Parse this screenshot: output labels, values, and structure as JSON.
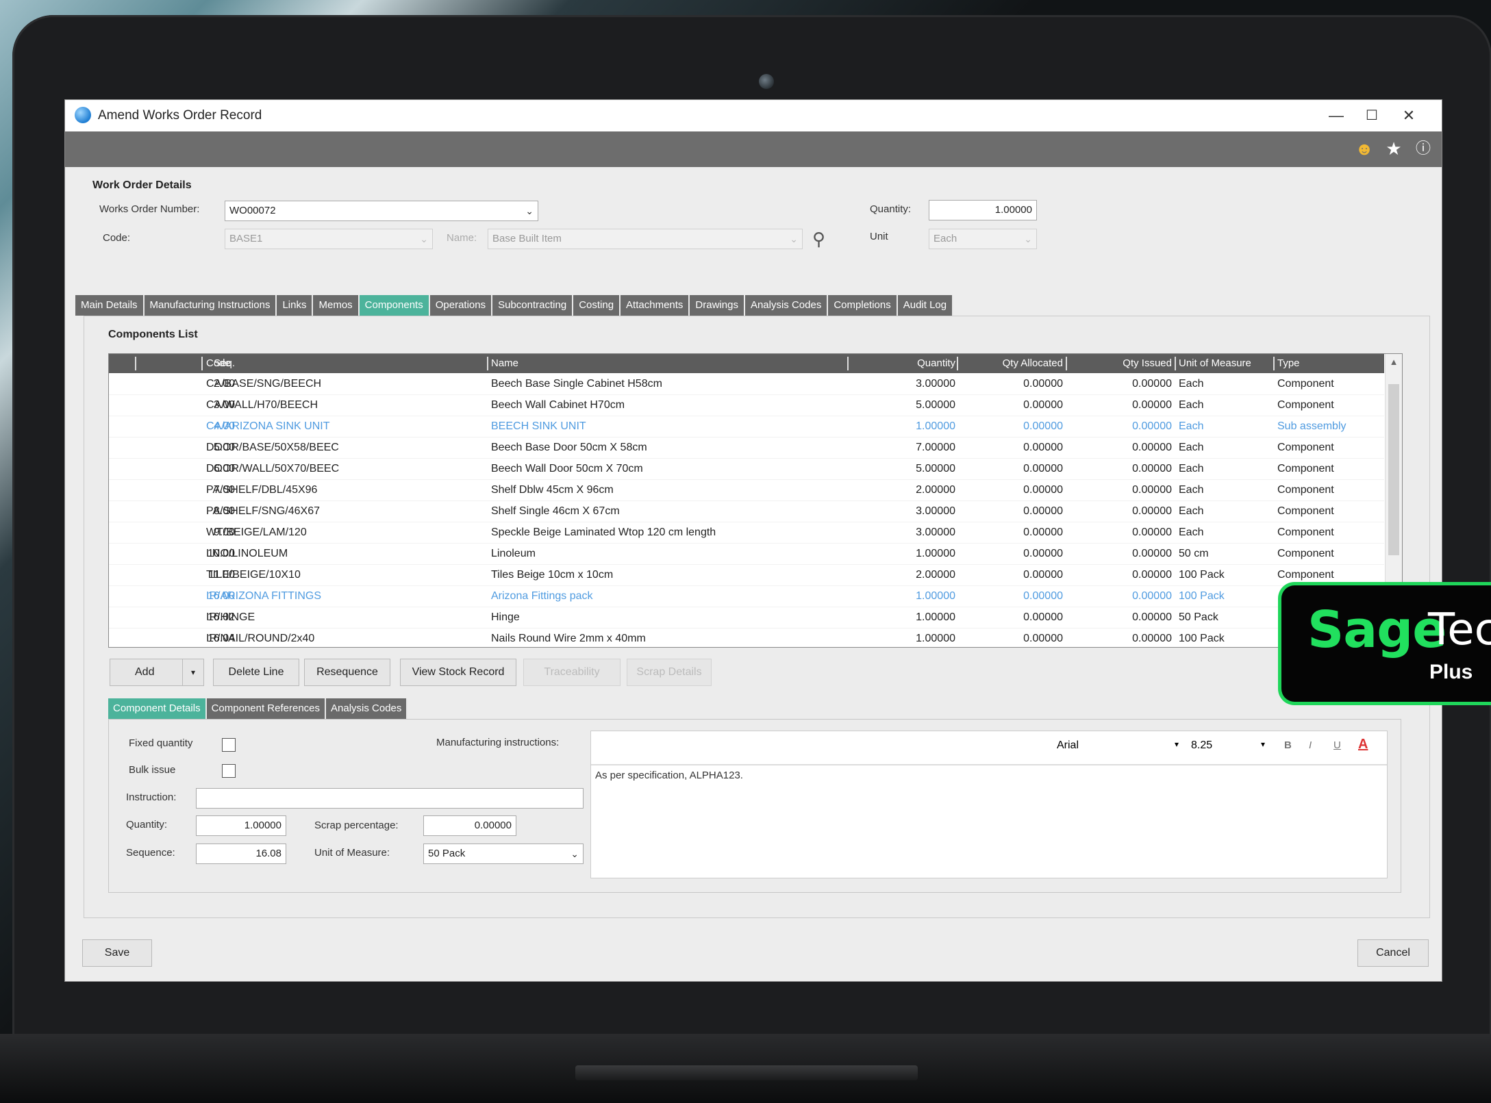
{
  "window": {
    "title": "Amend Works Order Record",
    "controls": {
      "minimize": "—",
      "maximize": "☐",
      "close": "✕"
    },
    "toolbar_icons": [
      "smiley-icon",
      "star-icon",
      "help-icon"
    ]
  },
  "work_order": {
    "section_title": "Work Order Details",
    "number_label": "Works Order Number:",
    "number_value": "WO00072",
    "code_label": "Code:",
    "code_value": "BASE1",
    "name_label": "Name:",
    "name_value": "Base Built Item",
    "quantity_label": "Quantity:",
    "quantity_value": "1.00000",
    "unit_label": "Unit",
    "unit_value": "Each"
  },
  "tabs": [
    {
      "label": "Main Details"
    },
    {
      "label": "Manufacturing Instructions"
    },
    {
      "label": "Links"
    },
    {
      "label": "Memos"
    },
    {
      "label": "Components",
      "active": true
    },
    {
      "label": "Operations"
    },
    {
      "label": "Subcontracting"
    },
    {
      "label": "Costing"
    },
    {
      "label": "Attachments"
    },
    {
      "label": "Drawings"
    },
    {
      "label": "Analysis Codes"
    },
    {
      "label": "Completions"
    },
    {
      "label": "Audit Log"
    }
  ],
  "components": {
    "section_title": "Components List",
    "columns": {
      "seq": "Seq.",
      "code": "Code",
      "name": "Name",
      "quantity": "Quantity",
      "qty_allocated": "Qty Allocated",
      "qty_issued": "Qty Issued",
      "unit_of_measure": "Unit of Measure",
      "type": "Type"
    },
    "rows": [
      {
        "seq": "2.00",
        "code": "CA/BASE/SNG/BEECH",
        "name": "Beech Base Single Cabinet H58cm",
        "quantity": "3.00000",
        "qty_allocated": "0.00000",
        "qty_issued": "0.00000",
        "uom": "Each",
        "type": "Component"
      },
      {
        "seq": "3.00",
        "code": "CA/WALL/H70/BEECH",
        "name": "Beech Wall Cabinet H70cm",
        "quantity": "5.00000",
        "qty_allocated": "0.00000",
        "qty_issued": "0.00000",
        "uom": "Each",
        "type": "Component"
      },
      {
        "seq": "4.00",
        "code": "CA/ARIZONA SINK UNIT",
        "name": "BEECH SINK UNIT",
        "quantity": "1.00000",
        "qty_allocated": "0.00000",
        "qty_issued": "0.00000",
        "uom": "Each",
        "type": "Sub assembly",
        "sub": true
      },
      {
        "seq": "5.00",
        "code": "DOOR/BASE/50X58/BEEC",
        "name": "Beech Base Door 50cm X 58cm",
        "quantity": "7.00000",
        "qty_allocated": "0.00000",
        "qty_issued": "0.00000",
        "uom": "Each",
        "type": "Component"
      },
      {
        "seq": "6.00",
        "code": "DOOR/WALL/50X70/BEEC",
        "name": "Beech Wall Door 50cm X 70cm",
        "quantity": "5.00000",
        "qty_allocated": "0.00000",
        "qty_issued": "0.00000",
        "uom": "Each",
        "type": "Component"
      },
      {
        "seq": "7.00",
        "code": "PA/SHELF/DBL/45X96",
        "name": "Shelf Dblw 45cm X 96cm",
        "quantity": "2.00000",
        "qty_allocated": "0.00000",
        "qty_issued": "0.00000",
        "uom": "Each",
        "type": "Component"
      },
      {
        "seq": "8.00",
        "code": "PA/SHELF/SNG/46X67",
        "name": "Shelf  Single 46cm X 67cm",
        "quantity": "3.00000",
        "qty_allocated": "0.00000",
        "qty_issued": "0.00000",
        "uom": "Each",
        "type": "Component"
      },
      {
        "seq": "9.00",
        "code": "WT/BEIGE/LAM/120",
        "name": "Speckle Beige Laminated Wtop 120 cm length",
        "quantity": "3.00000",
        "qty_allocated": "0.00000",
        "qty_issued": "0.00000",
        "uom": "Each",
        "type": "Component"
      },
      {
        "seq": "10.00",
        "code": "LNO/LINOLEUM",
        "name": "Linoleum",
        "quantity": "1.00000",
        "qty_allocated": "0.00000",
        "qty_issued": "0.00000",
        "uom": "50 cm",
        "type": "Component"
      },
      {
        "seq": "11.00",
        "code": "TILE/BEIGE/10X10",
        "name": "Tiles Beige 10cm x 10cm",
        "quantity": "2.00000",
        "qty_allocated": "0.00000",
        "qty_issued": "0.00000",
        "uom": "100 Pack",
        "type": "Component"
      },
      {
        "seq": "16.00",
        "code": "IR/ARIZONA FITTINGS",
        "name": "Arizona Fittings pack",
        "quantity": "1.00000",
        "qty_allocated": "0.00000",
        "qty_issued": "0.00000",
        "uom": "100 Pack",
        "type": "",
        "sub": true
      },
      {
        "seq": "16.02",
        "code": "IR/HINGE",
        "name": "Hinge",
        "quantity": "1.00000",
        "qty_allocated": "0.00000",
        "qty_issued": "0.00000",
        "uom": "50 Pack",
        "type": ""
      },
      {
        "seq": "16.04",
        "code": "IR/NAIL/ROUND/2x40",
        "name": "Nails Round Wire 2mm x 40mm",
        "quantity": "1.00000",
        "qty_allocated": "0.00000",
        "qty_issued": "0.00000",
        "uom": "100 Pack",
        "type": ""
      }
    ]
  },
  "actions": {
    "add": "Add",
    "delete_line": "Delete Line",
    "resequence": "Resequence",
    "view_stock_record": "View Stock Record",
    "traceability": "Traceability",
    "scrap_details": "Scrap Details"
  },
  "subtabs": [
    {
      "label": "Component Details",
      "active": true
    },
    {
      "label": "Component References"
    },
    {
      "label": "Analysis Codes"
    }
  ],
  "component_details": {
    "fixed_quantity_label": "Fixed quantity",
    "bulk_issue_label": "Bulk issue",
    "instruction_label": "Instruction:",
    "instruction_value": "",
    "quantity_label": "Quantity:",
    "quantity_value": "1.00000",
    "sequence_label": "Sequence:",
    "sequence_value": "16.08",
    "scrap_label": "Scrap percentage:",
    "scrap_value": "0.00000",
    "uom_label": "Unit of Measure:",
    "uom_value": "50 Pack",
    "mfg_label": "Manufacturing instructions:",
    "font_name": "Arial",
    "font_size": "8.25",
    "bold": "B",
    "italic": "I",
    "underline": "U",
    "editor_text": "As per specification, ALPHA123."
  },
  "footer": {
    "save": "Save",
    "cancel": "Cancel"
  },
  "badge": {
    "brand": "Sage",
    "suffix": "Tec",
    "plus": "Plus"
  },
  "colors": {
    "accent": "#4cb39b",
    "sub_assembly": "#4f9be0",
    "badge_green": "#21e05e"
  }
}
